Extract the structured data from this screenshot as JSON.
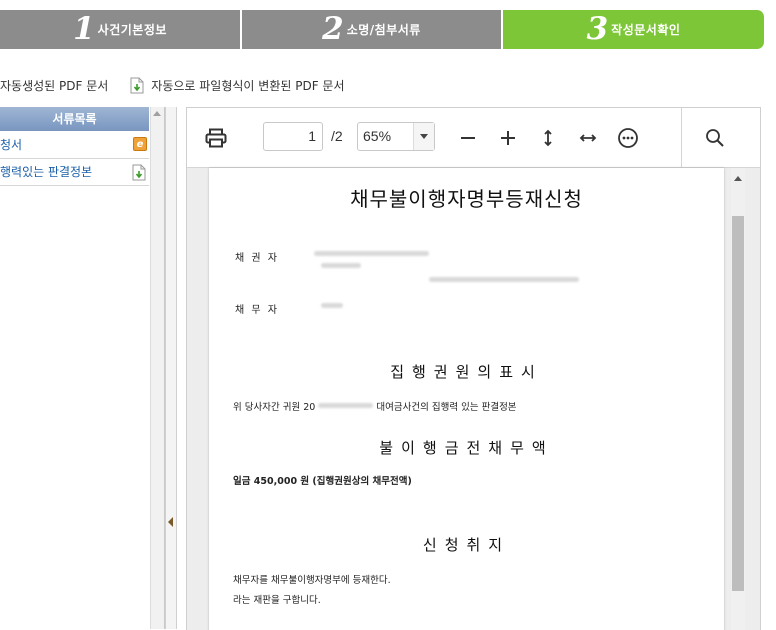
{
  "steps": [
    {
      "num": "1",
      "label": "사건기본정보",
      "state": "inactive"
    },
    {
      "num": "2",
      "label": "소명/첨부서류",
      "state": "inactive"
    },
    {
      "num": "3",
      "label": "작성문서확인",
      "state": "active"
    }
  ],
  "colors": {
    "step_inactive": "#8c8c8c",
    "step_active": "#7dc638",
    "list_header": "#8aa6cc",
    "link": "#1a5fa8"
  },
  "legend": {
    "auto_pdf": "자동생성된 PDF 문서",
    "converted_pdf": "자동으로 파일형식이 변환된 PDF 문서"
  },
  "doc_list": {
    "header": "서류목록",
    "items": [
      {
        "label": "청서",
        "icon": "edit-icon"
      },
      {
        "label": "행력있는 판결정본",
        "icon": "pdf-convert-icon"
      }
    ]
  },
  "viewer": {
    "page_current": "1",
    "page_total": "/2",
    "zoom": "65%",
    "icons": [
      "print-icon",
      "zoom-out-icon",
      "zoom-in-icon",
      "fit-page-icon",
      "fit-width-icon",
      "more-icon",
      "search-icon"
    ]
  },
  "document": {
    "title": "채무불이행자명부등재신청",
    "creditor_label": "채 권 자",
    "debtor_label": "채 무 자",
    "section_exec": "집행권원의표시",
    "exec_text_prefix": "위 당사자간 귀원 20",
    "exec_text_suffix": "대여금사건의 집행력 있는 판결정본",
    "section_amount": "불이행금전채무액",
    "amount_text": "일금 450,000 원  (집행권원상의 채무전액)",
    "section_purpose": "신청취지",
    "purpose_line1": "채무자를 채무불이행자명부에 등재한다.",
    "purpose_line2": "라는 재판을 구합니다."
  }
}
